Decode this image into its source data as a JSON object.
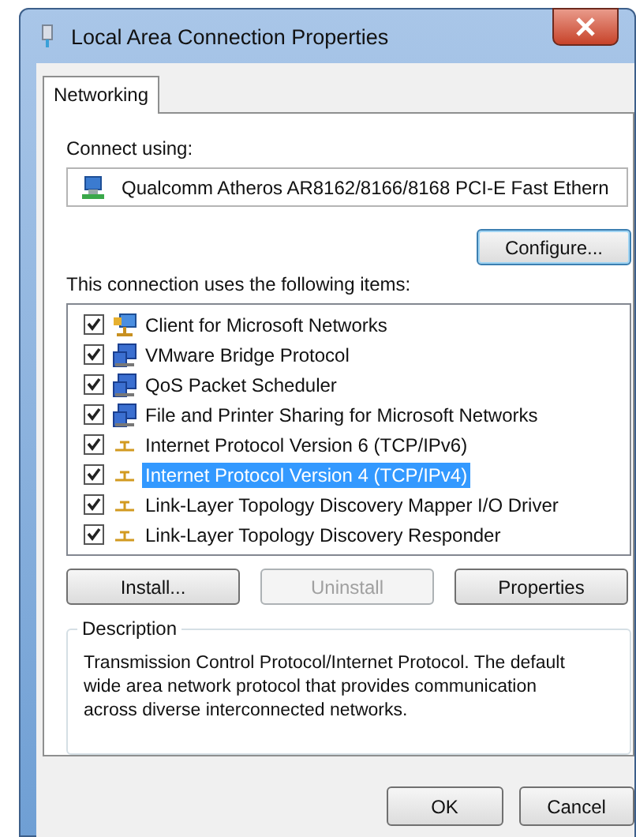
{
  "window": {
    "title": "Local Area Connection Properties"
  },
  "tabs": [
    {
      "label": "Networking",
      "selected": true
    }
  ],
  "connect_using": {
    "label": "Connect using:",
    "adapter": "Qualcomm Atheros AR8162/8166/8168 PCI-E Fast Ethern"
  },
  "configure_button": "Configure...",
  "items_label": "This connection uses the following items:",
  "items": [
    {
      "label": "Client for Microsoft Networks",
      "kind": "client",
      "checked": true,
      "selected": false
    },
    {
      "label": "VMware Bridge Protocol",
      "kind": "service",
      "checked": true,
      "selected": false
    },
    {
      "label": "QoS Packet Scheduler",
      "kind": "service",
      "checked": true,
      "selected": false
    },
    {
      "label": "File and Printer Sharing for Microsoft Networks",
      "kind": "service",
      "checked": true,
      "selected": false
    },
    {
      "label": "Internet Protocol Version 6 (TCP/IPv6)",
      "kind": "protocol",
      "checked": true,
      "selected": false
    },
    {
      "label": "Internet Protocol Version 4 (TCP/IPv4)",
      "kind": "protocol",
      "checked": true,
      "selected": true
    },
    {
      "label": "Link-Layer Topology Discovery Mapper I/O Driver",
      "kind": "protocol",
      "checked": true,
      "selected": false
    },
    {
      "label": "Link-Layer Topology Discovery Responder",
      "kind": "protocol",
      "checked": true,
      "selected": false
    }
  ],
  "item_buttons": [
    {
      "label": "Install...",
      "disabled": false
    },
    {
      "label": "Uninstall",
      "disabled": true
    },
    {
      "label": "Properties",
      "disabled": false
    }
  ],
  "description": {
    "title": "Description",
    "text": "Transmission Control Protocol/Internet Protocol. The default wide area network protocol that provides communication across diverse interconnected networks."
  },
  "dialog_buttons": [
    {
      "label": "OK"
    },
    {
      "label": "Cancel"
    }
  ]
}
